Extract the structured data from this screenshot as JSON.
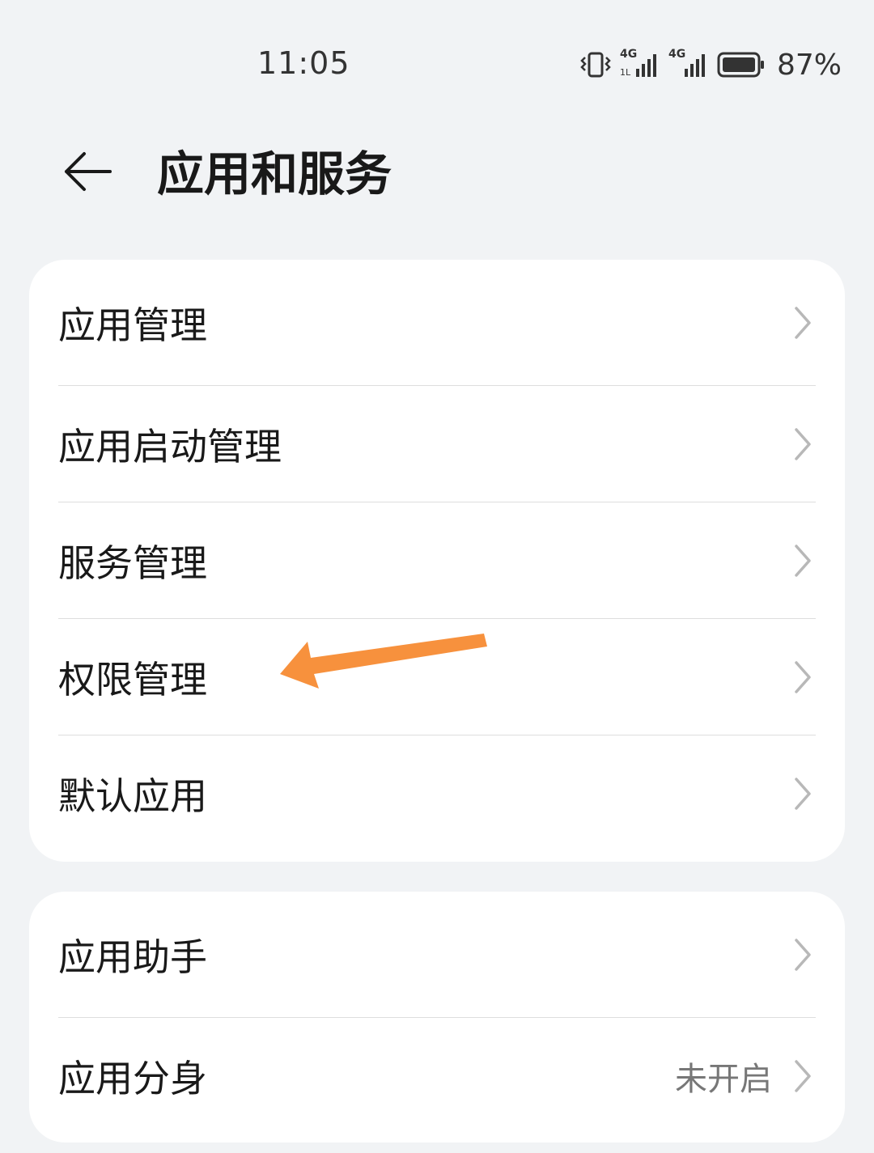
{
  "status_bar": {
    "time": "11:05",
    "battery_percent": "87%",
    "signal_1_label": "4G",
    "signal_2_label": "4G",
    "icons": [
      "vibrate-icon",
      "signal-4g-icon",
      "signal-4g-icon",
      "battery-icon"
    ]
  },
  "header": {
    "title": "应用和服务",
    "back_icon": "arrow-left-icon"
  },
  "groups": [
    {
      "items": [
        {
          "label": "应用管理"
        },
        {
          "label": "应用启动管理"
        },
        {
          "label": "服务管理"
        },
        {
          "label": "权限管理"
        },
        {
          "label": "默认应用"
        }
      ]
    },
    {
      "items": [
        {
          "label": "应用助手"
        },
        {
          "label": "应用分身",
          "value": "未开启"
        }
      ]
    }
  ],
  "colors": {
    "background": "#f1f3f5",
    "card": "#ffffff",
    "annotation_arrow": "#f7913d"
  }
}
